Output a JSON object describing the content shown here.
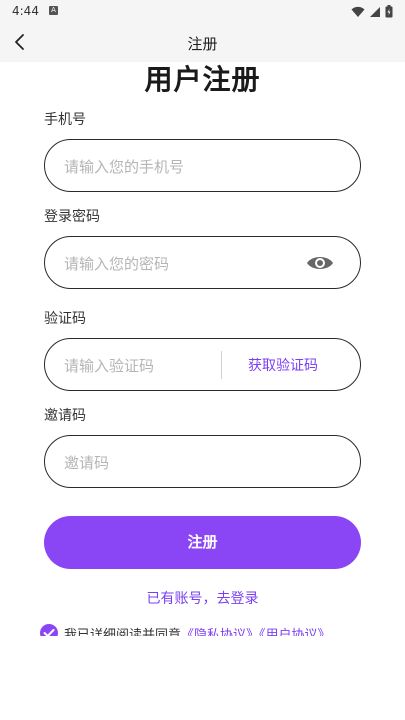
{
  "status_bar": {
    "time": "4:44",
    "notification_badge": "A"
  },
  "nav": {
    "title": "注册",
    "back_icon": "chevron-left-icon"
  },
  "page_title": "用户注册",
  "form": {
    "phone": {
      "label": "手机号",
      "value": "",
      "placeholder": "请输入您的手机号"
    },
    "password": {
      "label": "登录密码",
      "value": "",
      "placeholder": "请输入您的密码",
      "toggle_icon": "eye-icon"
    },
    "code": {
      "label": "验证码",
      "value": "",
      "placeholder": "请输入验证码",
      "get_code_label": "获取验证码"
    },
    "invite": {
      "label": "邀请码",
      "value": "",
      "placeholder": "邀请码"
    }
  },
  "submit_label": "注册",
  "login_link": "已有账号，去登录",
  "agreement": {
    "checked": true,
    "text": "我已详细阅读并同意",
    "privacy_link": "《隐私协议》",
    "user_link": "《用户协议》"
  },
  "colors": {
    "accent": "#8a46f5",
    "link": "#7b3ff2",
    "bar_bg": "#f5f5f5"
  }
}
